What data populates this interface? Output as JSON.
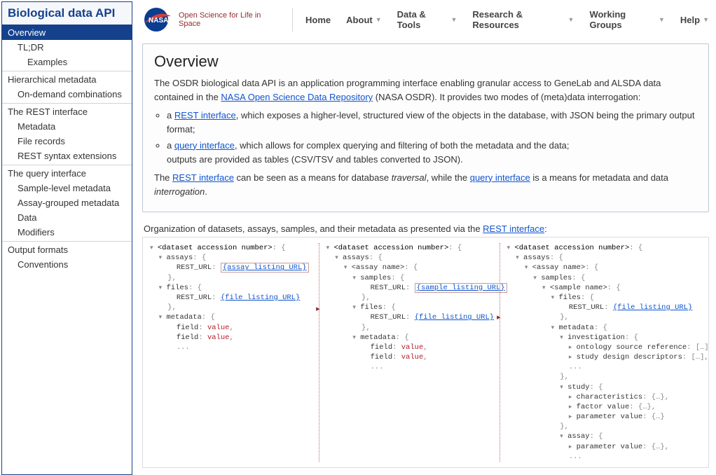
{
  "sidebar": {
    "title": "Biological data API",
    "items": [
      {
        "label": "Overview",
        "selected": true
      },
      {
        "label": "TL;DR",
        "indent": 1
      },
      {
        "label": "Examples",
        "indent": 2
      },
      {
        "label": "Hierarchical metadata",
        "group": true
      },
      {
        "label": "On-demand combinations",
        "indent": 1
      },
      {
        "label": "The REST interface",
        "group": true
      },
      {
        "label": "Metadata",
        "indent": 1
      },
      {
        "label": "File records",
        "indent": 1
      },
      {
        "label": "REST syntax extensions",
        "indent": 1
      },
      {
        "label": "The query interface",
        "group": true
      },
      {
        "label": "Sample-level metadata",
        "indent": 1
      },
      {
        "label": "Assay-grouped metadata",
        "indent": 1
      },
      {
        "label": "Data",
        "indent": 1
      },
      {
        "label": "Modifiers",
        "indent": 1
      },
      {
        "label": "Output formats",
        "group": true
      },
      {
        "label": "Conventions",
        "indent": 1
      }
    ]
  },
  "header": {
    "tagline": "Open Science for Life in Space",
    "menu": [
      "Home",
      "About",
      "Data & Tools",
      "Research & Resources",
      "Working Groups",
      "Help"
    ],
    "dropdown": [
      false,
      true,
      true,
      true,
      true,
      true
    ]
  },
  "overview": {
    "title": "Overview",
    "p1a": "The OSDR biological data API is an application programming interface enabling granular access to GeneLab and ALSDA data contained in the ",
    "p1link": "NASA Open Science Data Repository",
    "p1b": " (NASA OSDR). It provides two modes of (meta)data interrogation:",
    "li1a": "a ",
    "li1link": "REST interface",
    "li1b": ", which exposes a higher-level, structured view of the objects in the database, with JSON being the primary output format;",
    "li2a": "a ",
    "li2link": "query interface",
    "li2b": ", which allows for complex querying and filtering of both the metadata and the data;",
    "li2c": "outputs are provided as tables (CSV/TSV and tables converted to JSON).",
    "p2a": "The ",
    "p2link1": "REST interface",
    "p2b": " can be seen as a means for database ",
    "p2em1": "traversal",
    "p2c": ", while the ",
    "p2link2": "query interface",
    "p2d": " is a means for metadata and data ",
    "p2em2": "interrogation",
    "p2e": "."
  },
  "diagram": {
    "caption_a": "Organization of datasets, assays, samples, and their metadata as presented via the ",
    "caption_link": "REST interface",
    "caption_b": ":",
    "tokens": {
      "dataset": "<dataset accession number>",
      "assays": "assays",
      "assay_name": "<assay name>",
      "samples": "samples",
      "sample_name": "<sample name>",
      "files": "files",
      "rest_url": "REST_URL",
      "metadata": "metadata",
      "field": "field",
      "value": "value",
      "ellipsis": "...",
      "investigation": "investigation",
      "ont_src_ref": "ontology source reference",
      "study_design": "study design descriptors",
      "study": "study",
      "characteristics": "characteristics",
      "factor_value": "factor value",
      "parameter_value": "parameter value",
      "assay": "assay",
      "url_assay": "{assay listing URL}",
      "url_file": "{file listing URL}",
      "url_sample": "{sample listing URL}",
      "brace_ellipsis": "{…}",
      "bracket_ellipsis": "[…]"
    }
  }
}
